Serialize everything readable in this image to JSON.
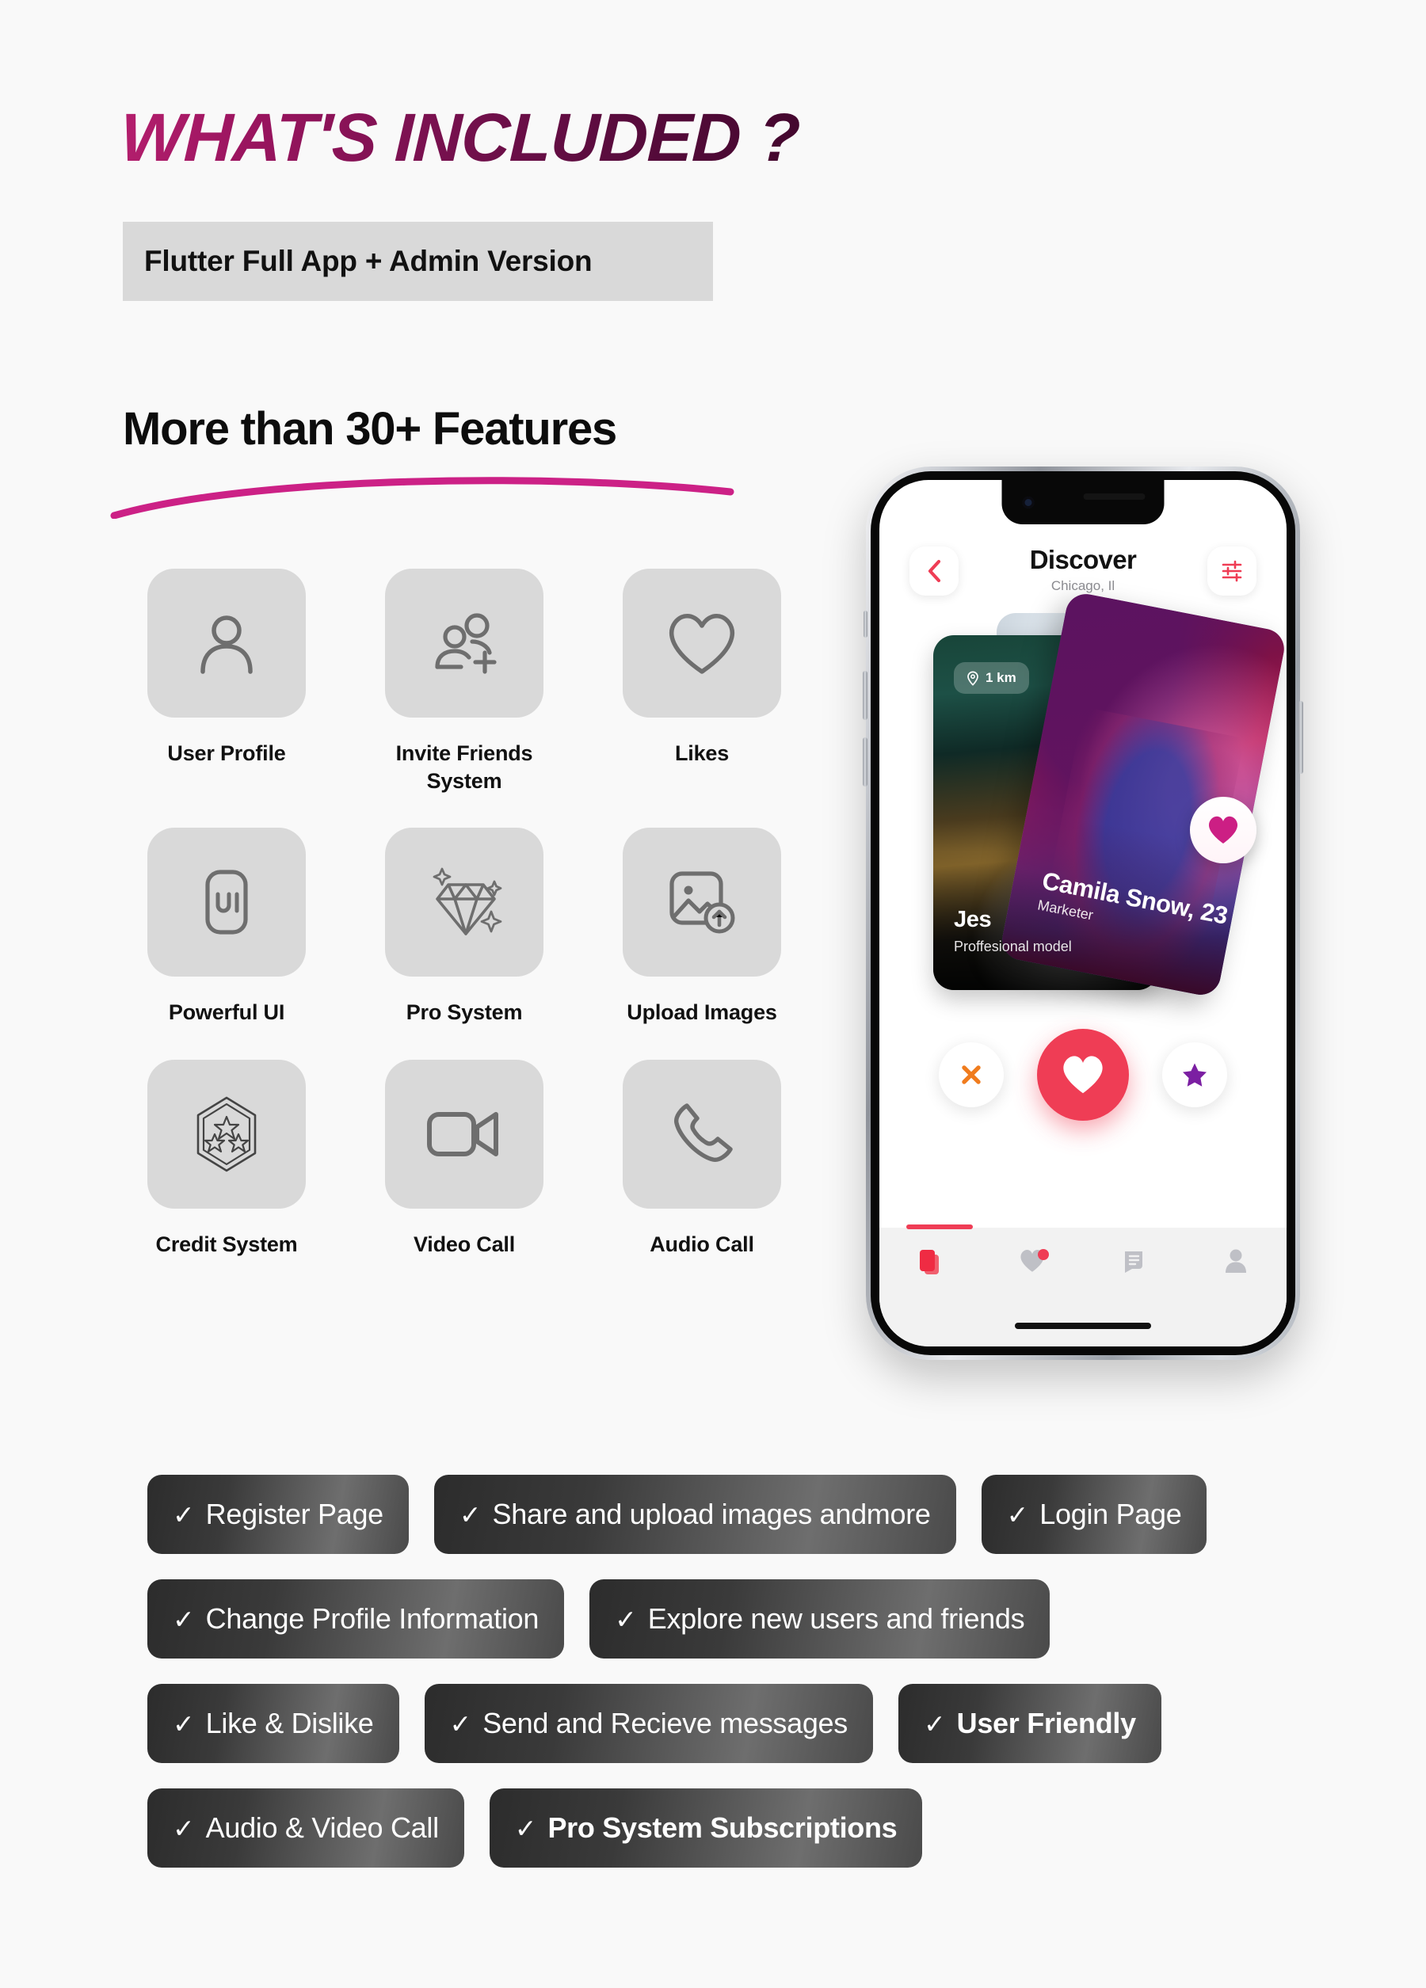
{
  "header": {
    "title": "WHAT'S INCLUDED ?",
    "badge": "Flutter Full App + Admin Version"
  },
  "section": {
    "title": "More than 30+ Features"
  },
  "features": [
    {
      "label": "User Profile",
      "icon": "user-profile-icon"
    },
    {
      "label": "Invite Friends\nSystem",
      "icon": "invite-friends-icon"
    },
    {
      "label": "Likes",
      "icon": "heart-icon"
    },
    {
      "label": "Powerful UI",
      "icon": "ui-icon"
    },
    {
      "label": "Pro System",
      "icon": "diamond-icon"
    },
    {
      "label": "Upload Images",
      "icon": "upload-image-icon"
    },
    {
      "label": "Credit System",
      "icon": "credit-badge-icon"
    },
    {
      "label": "Video Call",
      "icon": "video-camera-icon"
    },
    {
      "label": "Audio Call",
      "icon": "phone-icon"
    }
  ],
  "phone": {
    "app_title": "Discover",
    "app_location": "Chicago, Il",
    "back_icon": "chevron-left-icon",
    "filter_icon": "filter-sliders-icon",
    "distance_badge": "1 km",
    "back_card": {
      "name": "Jes",
      "role": "Proffesional model"
    },
    "front_card": {
      "name": "Camila Snow, 23",
      "role": "Marketer"
    },
    "actions": [
      {
        "name": "dislike",
        "icon": "x-icon"
      },
      {
        "name": "like",
        "icon": "heart-filled-icon"
      },
      {
        "name": "superlike",
        "icon": "star-icon"
      }
    ],
    "tabs": [
      {
        "name": "cards",
        "icon": "cards-stack-icon",
        "active": true,
        "badge": false
      },
      {
        "name": "matches",
        "icon": "heart-icon",
        "active": false,
        "badge": true
      },
      {
        "name": "messages",
        "icon": "chat-bubble-icon",
        "active": false,
        "badge": false
      },
      {
        "name": "profile",
        "icon": "person-icon",
        "active": false,
        "badge": false
      }
    ]
  },
  "pill_rows": [
    [
      {
        "label": "Register Page",
        "bold": false
      },
      {
        "label": "Share and upload images andmore",
        "bold": false
      },
      {
        "label": "Login Page",
        "bold": false
      }
    ],
    [
      {
        "label": "Change Profile Information",
        "bold": false
      },
      {
        "label": "Explore new users and friends",
        "bold": false
      }
    ],
    [
      {
        "label": "Like & Dislike",
        "bold": false
      },
      {
        "label": "Send and Recieve messages",
        "bold": false
      },
      {
        "label": "User Friendly",
        "bold": true
      }
    ],
    [
      {
        "label": "Audio & Video Call",
        "bold": false
      },
      {
        "label": "Pro System Subscriptions",
        "bold": true
      }
    ]
  ],
  "check_glyph": "✓",
  "colors": {
    "background": "#f9f9f9",
    "title_gradient_start": "#b51f6e",
    "title_gradient_end": "#43072e",
    "swoosh": "#cc2186",
    "tile": "#d9d9d9",
    "icon": "#6e6e6e",
    "accent_red": "#ef3d55",
    "pill_dark": "#2c2c2c",
    "star_purple": "#7b1fa2",
    "x_orange": "#f07c1e"
  }
}
